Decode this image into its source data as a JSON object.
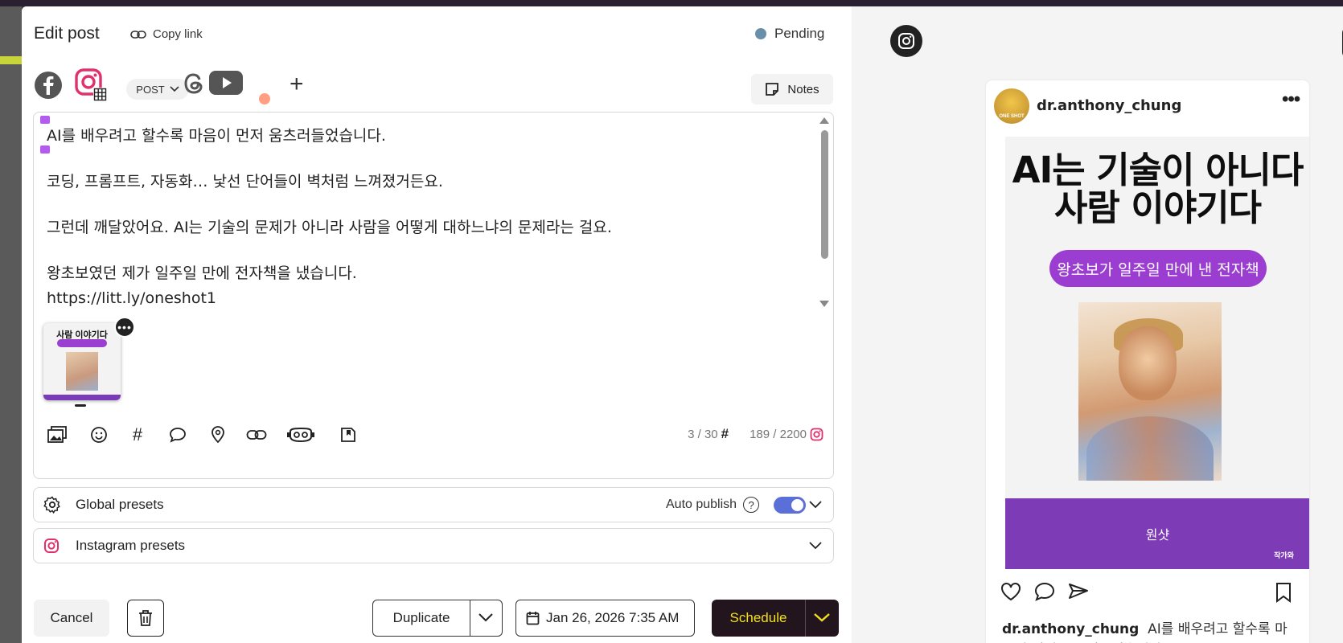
{
  "modal": {
    "title": "Edit post",
    "copy_link": "Copy link",
    "status": "Pending",
    "post_type": "POST",
    "notes_label": "Notes",
    "colors": {
      "accent": "#5b6fd8",
      "schedule_bg": "#23151e",
      "schedule_text": "#f2e01f",
      "status_dot": "#6a8fa8",
      "instagram": "#e1306c"
    }
  },
  "channels": [
    {
      "name": "facebook-icon"
    },
    {
      "name": "instagram-icon",
      "selected": true
    },
    {
      "name": "threads-icon"
    },
    {
      "name": "youtube-icon"
    }
  ],
  "compose": {
    "lines": [
      "AI를 배우려고 할수록 마음이 먼저 움츠러들었습니다.",
      "",
      "코딩, 프롬프트, 자동화… 낯선 단어들이 벽처럼 느껴졌거든요.",
      "",
      "그런데 깨달았어요. AI는 기술의 문제가 아니라 사람을 어떻게 대하느냐의 문제라는 걸요.",
      "",
      "왕초보였던 제가 일주일 만에 전자책을 냈습니다.",
      "https://litt.ly/oneshot1"
    ],
    "hashtag_count": "3 / 30",
    "char_count": "189 / 2200",
    "thumbnail_title": "사람 이야기다"
  },
  "toolbar": [
    "media-library-icon",
    "emoji-icon",
    "hashtag-icon",
    "comment-icon",
    "location-icon",
    "link-icon",
    "ai-assistant-icon",
    "story-icon"
  ],
  "presets": {
    "global": "Global presets",
    "auto_publish": "Auto publish",
    "auto_publish_on": true,
    "instagram": "Instagram presets"
  },
  "footer": {
    "cancel": "Cancel",
    "duplicate": "Duplicate",
    "date": "Jan 26, 2026 7:35 AM",
    "schedule": "Schedule"
  },
  "preview": {
    "username": "dr.anthony_chung",
    "avatar_text": "ONE SHOT",
    "image_title_1": "AI는 기술이 아니다",
    "image_title_2": "사람 이야기다",
    "image_pill": "왕초보가 일주일 만에 낸 전자책",
    "band_title": "원샷",
    "band_sub": "작가와",
    "caption_user": "dr.anthony_chung",
    "caption_text": "AI를 배우려고 할수록 마음이 먼저 움츠러들었습니다."
  }
}
